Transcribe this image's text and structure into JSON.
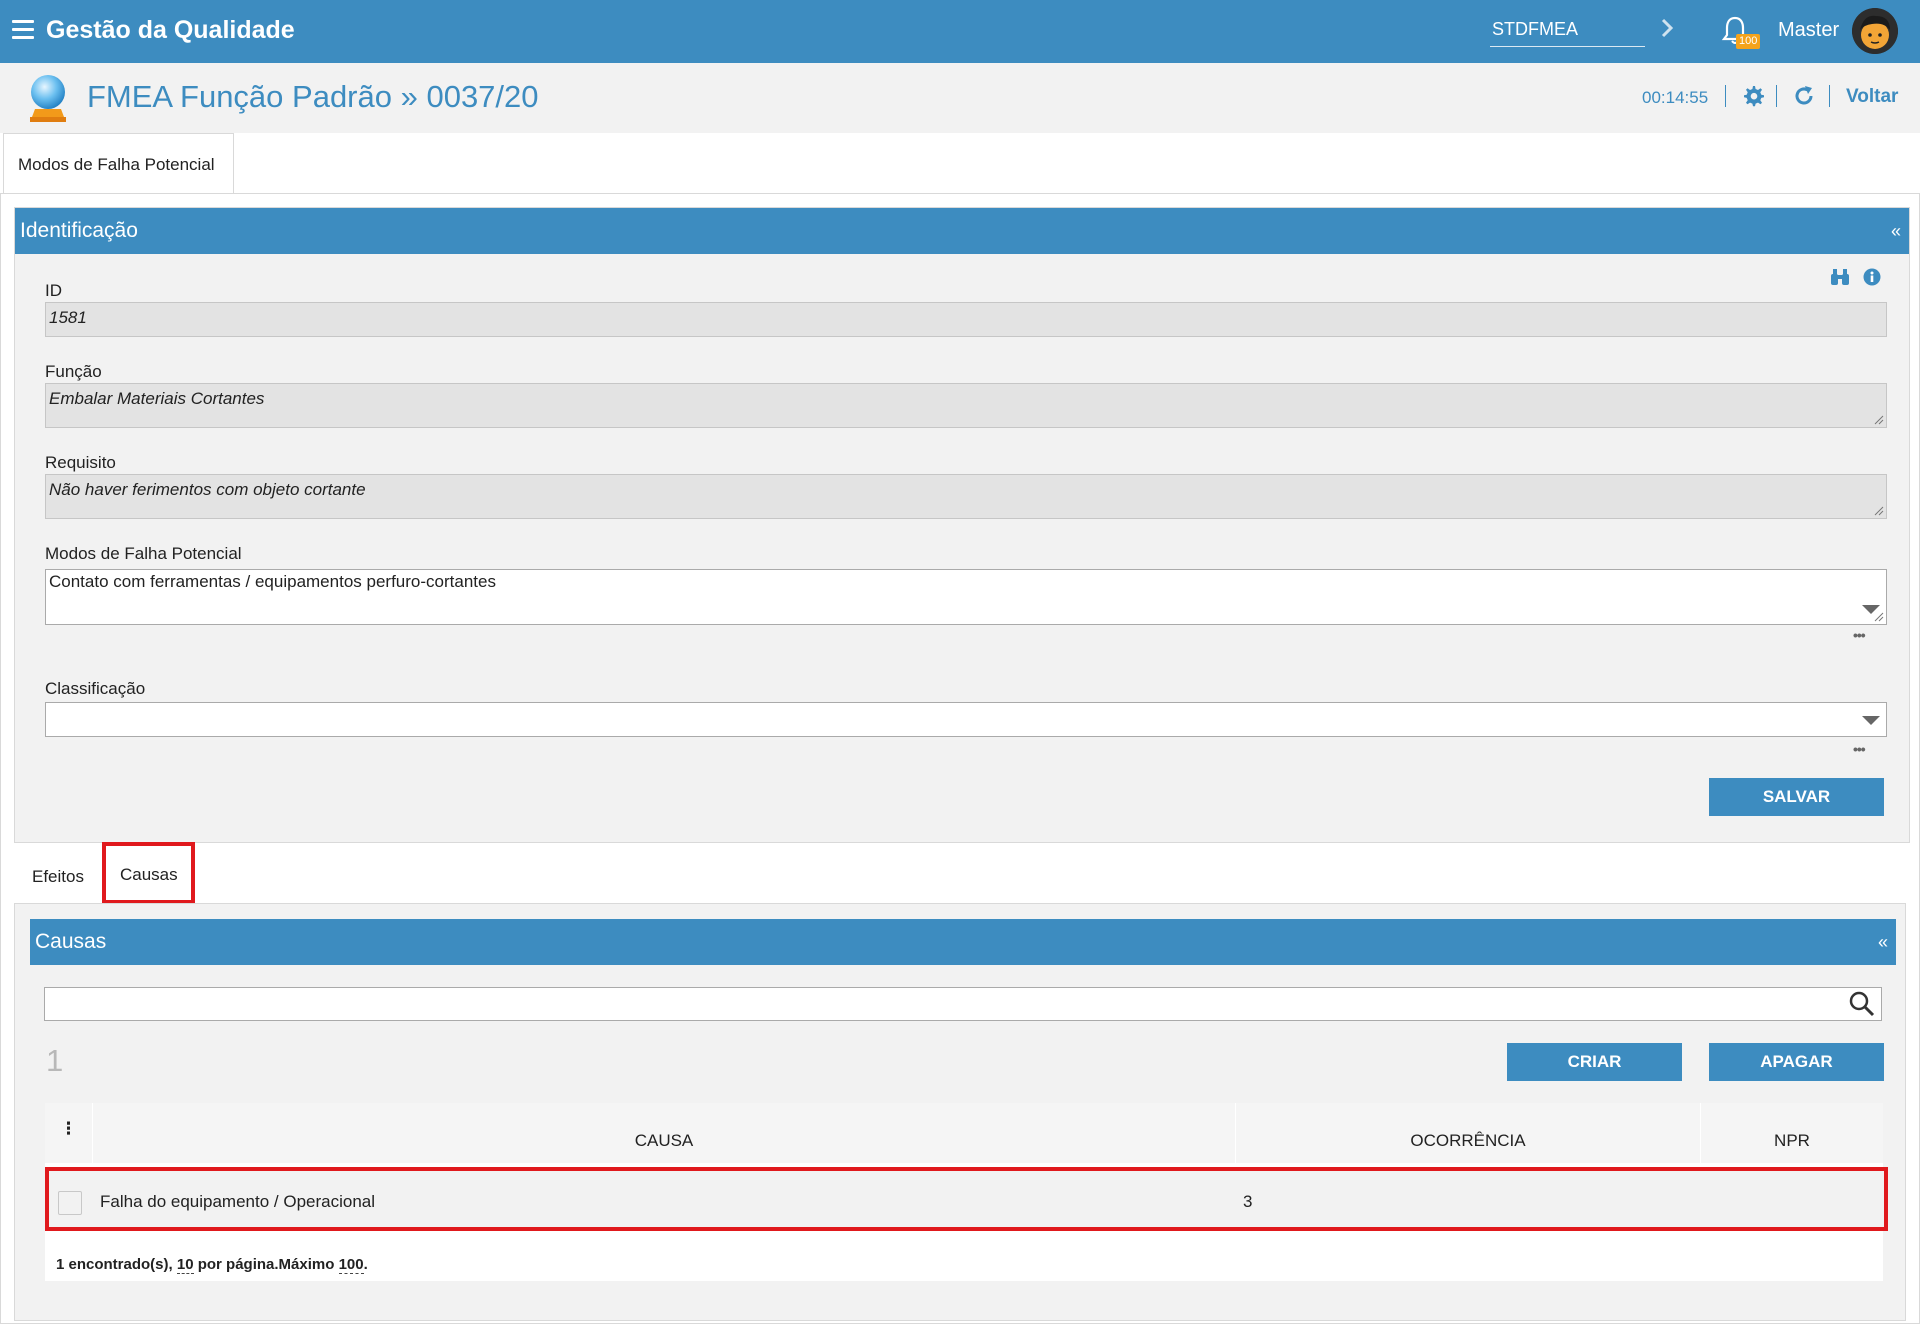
{
  "topbar": {
    "app_title": "Gestão da Qualidade",
    "module_code": "STDFMEA",
    "notification_count": "100",
    "user_name": "Master",
    "color": "#3d8cc0"
  },
  "page": {
    "title": "FMEA Função Padrão » 0037/20",
    "timer": "00:14:55",
    "back_label": "Voltar"
  },
  "main_tab": {
    "label": "Modos de Falha Potencial"
  },
  "identificacao": {
    "header": "Identificação",
    "collapse": "«",
    "id_label": "ID",
    "id_value": "1581",
    "funcao_label": "Função",
    "funcao_value": "Embalar Materiais Cortantes",
    "requisito_label": "Requisito",
    "requisito_value": "Não haver ferimentos com objeto cortante",
    "modos_label": "Modos de Falha Potencial",
    "modos_value": "Contato com ferramentas / equipamentos perfuro-cortantes",
    "classificacao_label": "Classificação",
    "classificacao_value": "",
    "more_dots": "•••",
    "save_label": "SALVAR"
  },
  "sub_tabs": [
    {
      "label": "Efeitos"
    },
    {
      "label": "Causas"
    }
  ],
  "causas": {
    "header": "Causas",
    "collapse": "«",
    "search_placeholder": "",
    "page_number": "1",
    "create_label": "CRIAR",
    "delete_label": "APAGAR",
    "columns": [
      "CAUSA",
      "OCORRÊNCIA",
      "NPR"
    ],
    "col_menu": "⋮",
    "rows": [
      {
        "causa": "Falha do equipamento / Operacional",
        "ocorrencia": "3",
        "npr": ""
      }
    ],
    "footer": {
      "found": "1 encontrado(s),",
      "per_page_value": "10",
      "per_page_text": "por página.Máximo",
      "max_value": "100",
      "end": "."
    }
  }
}
